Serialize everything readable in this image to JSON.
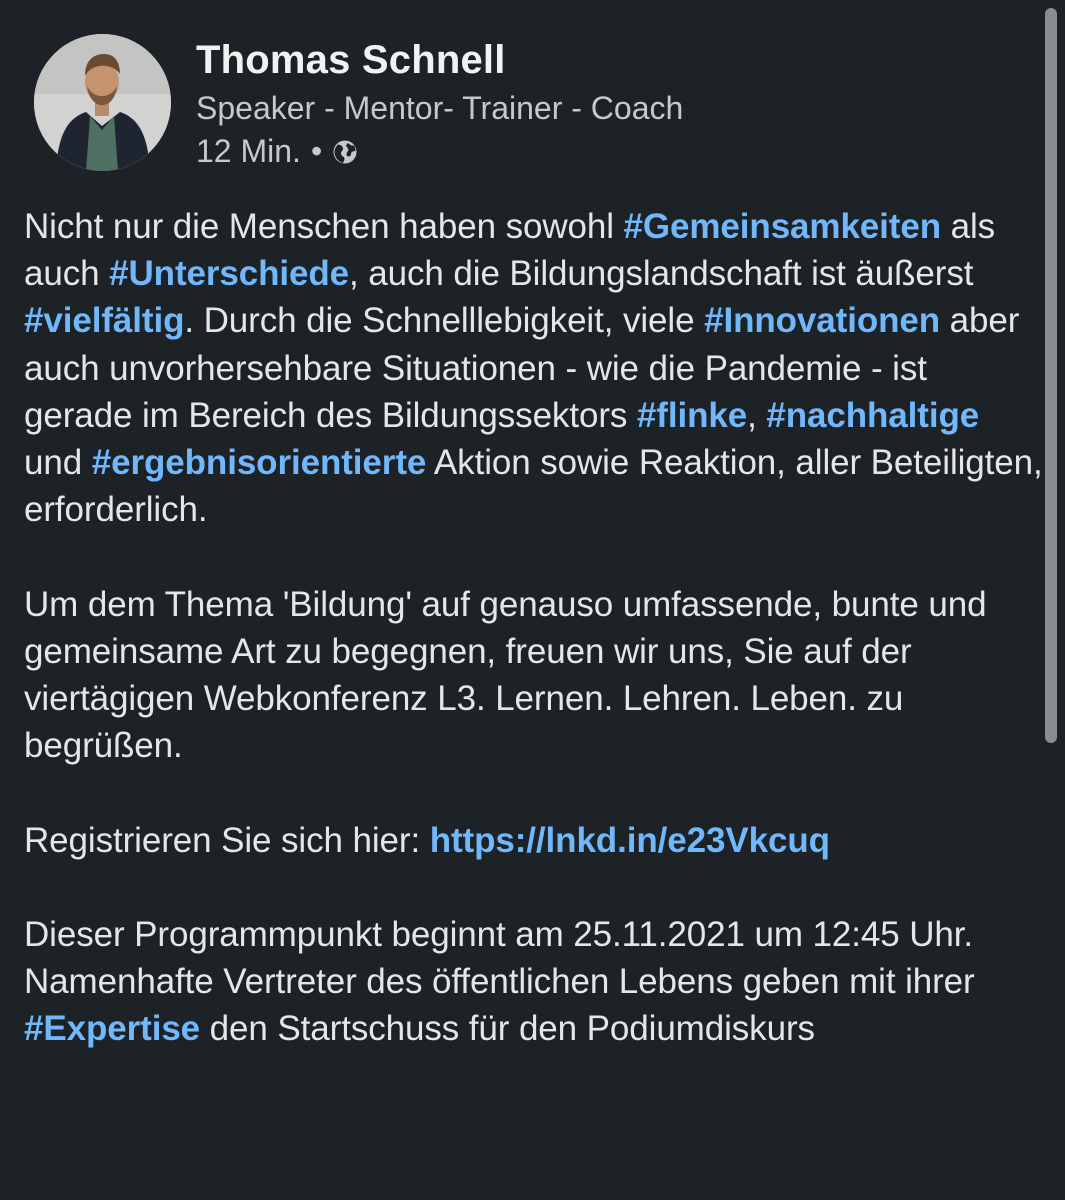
{
  "author": {
    "name": "Thomas Schnell",
    "headline": "Speaker - Mentor- Trainer - Coach",
    "time": "12 Min.",
    "separator": "•",
    "visibility_icon": "globe-icon"
  },
  "post": {
    "p1": {
      "t1": "Nicht nur die Menschen haben sowohl ",
      "h1": "#Gemeinsamkeiten",
      "t2": " als auch ",
      "h2": "#Unterschiede",
      "t3": ", auch die Bildungslandschaft ist äußerst ",
      "h3": "#vielfältig",
      "t4": ". Durch die Schnelllebigkeit, viele ",
      "h4": "#Innovationen",
      "t5": " aber auch unvorhersehbare Situationen - wie die Pandemie - ist gerade im Bereich des Bildungssektors ",
      "h5": "#flinke",
      "t6": ", ",
      "h6": "#nachhaltige",
      "t7": " und ",
      "h7": "#ergebnisorientierte",
      "t8": " Aktion sowie Reaktion, aller Beteiligten, erforderlich."
    },
    "p2": "Um dem Thema 'Bildung' auf genauso umfassende, bunte und gemeinsame Art zu begegnen, freuen wir uns, Sie auf der viertägigen Webkonferenz L3. Lernen. Lehren. Leben. zu begrüßen.",
    "p3": {
      "t1": "Registrieren Sie sich hier: ",
      "link": "https://lnkd.in/e23Vkcuq"
    },
    "p4": {
      "t1": "Dieser Programmpunkt beginnt am 25.11.2021 um 12:45 Uhr. Namenhafte Vertreter des öffentlichen Lebens geben mit ihrer ",
      "h1": "#Expertise",
      "t2": " den Startschuss für den Podiumdiskurs"
    }
  },
  "colors": {
    "background": "#1d2226",
    "hashtag": "#71b7fb",
    "text": "#e6e6e6",
    "secondary_text": "#c8c8c8"
  }
}
